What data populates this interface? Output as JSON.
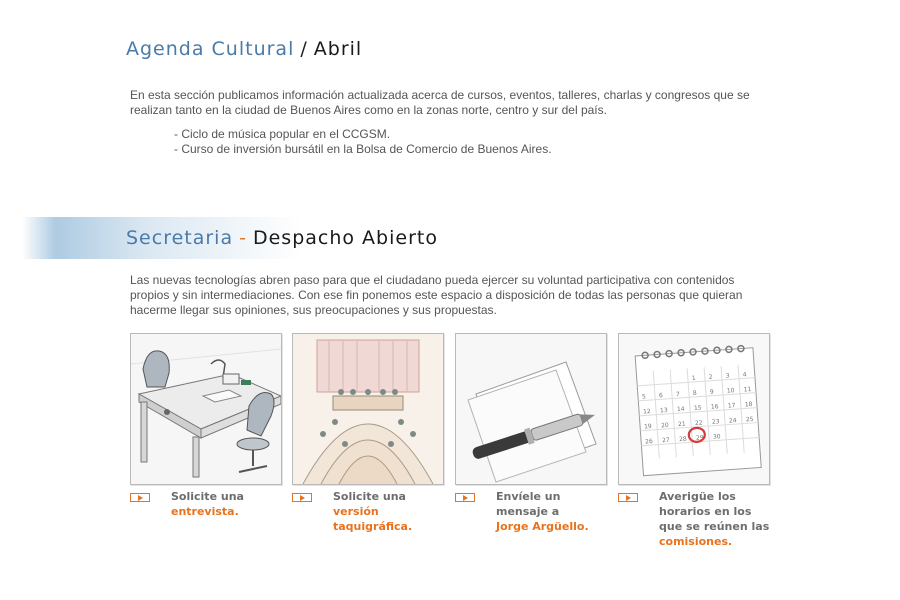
{
  "agenda": {
    "title_main": "Agenda Cultural",
    "title_sep": "/",
    "title_month": "Abril",
    "intro": "En esta sección publicamos información actualizada acerca de cursos, eventos, talleres, charlas y congresos que se realizan tanto en la ciudad de Buenos Aires como en la zonas norte, centro y sur del país.",
    "items": [
      "- Ciclo de música popular en el CCGSM.",
      "- Curso de inversión bursátil en la Bolsa de Comercio de Buenos Aires."
    ]
  },
  "secretaria": {
    "title_main": "Secretaria",
    "title_sep": "-",
    "title_sub": "Despacho Abierto",
    "intro": "Las nuevas tecnologías abren paso para que el ciudadano pueda ejercer su voluntad participativa con contenidos propios y sin intermediaciones. Con ese fin ponemos este espacio a disposición de todas las personas que quieran hacerme llegar sus opiniones, sus preocupaciones y sus propuestas.",
    "cards": [
      {
        "text": "Solicite una",
        "link": "entrevista.",
        "icon": "office-desk-illustration"
      },
      {
        "text": "Solicite una",
        "link": "versión taquigráfica.",
        "icon": "parliament-chamber-illustration"
      },
      {
        "text": "Envíele un mensaje a",
        "link": "Jorge Argüello.",
        "icon": "pen-and-paper-illustration"
      },
      {
        "text": "Averigüe los horarios en los que se reúnen las",
        "link": "comisiones.",
        "icon": "calendar-illustration"
      }
    ],
    "calendar_days": [
      "1",
      "2",
      "3",
      "4",
      "5",
      "6",
      "7",
      "8",
      "9",
      "10",
      "11",
      "12",
      "13",
      "14",
      "15",
      "16",
      "17",
      "18",
      "19",
      "20",
      "21",
      "22",
      "23",
      "24",
      "25",
      "26",
      "27",
      "28",
      "29",
      "30"
    ],
    "calendar_circled_day": "22"
  },
  "colors": {
    "accent_orange": "#e8731e",
    "title_blue": "#4a7aa8"
  }
}
